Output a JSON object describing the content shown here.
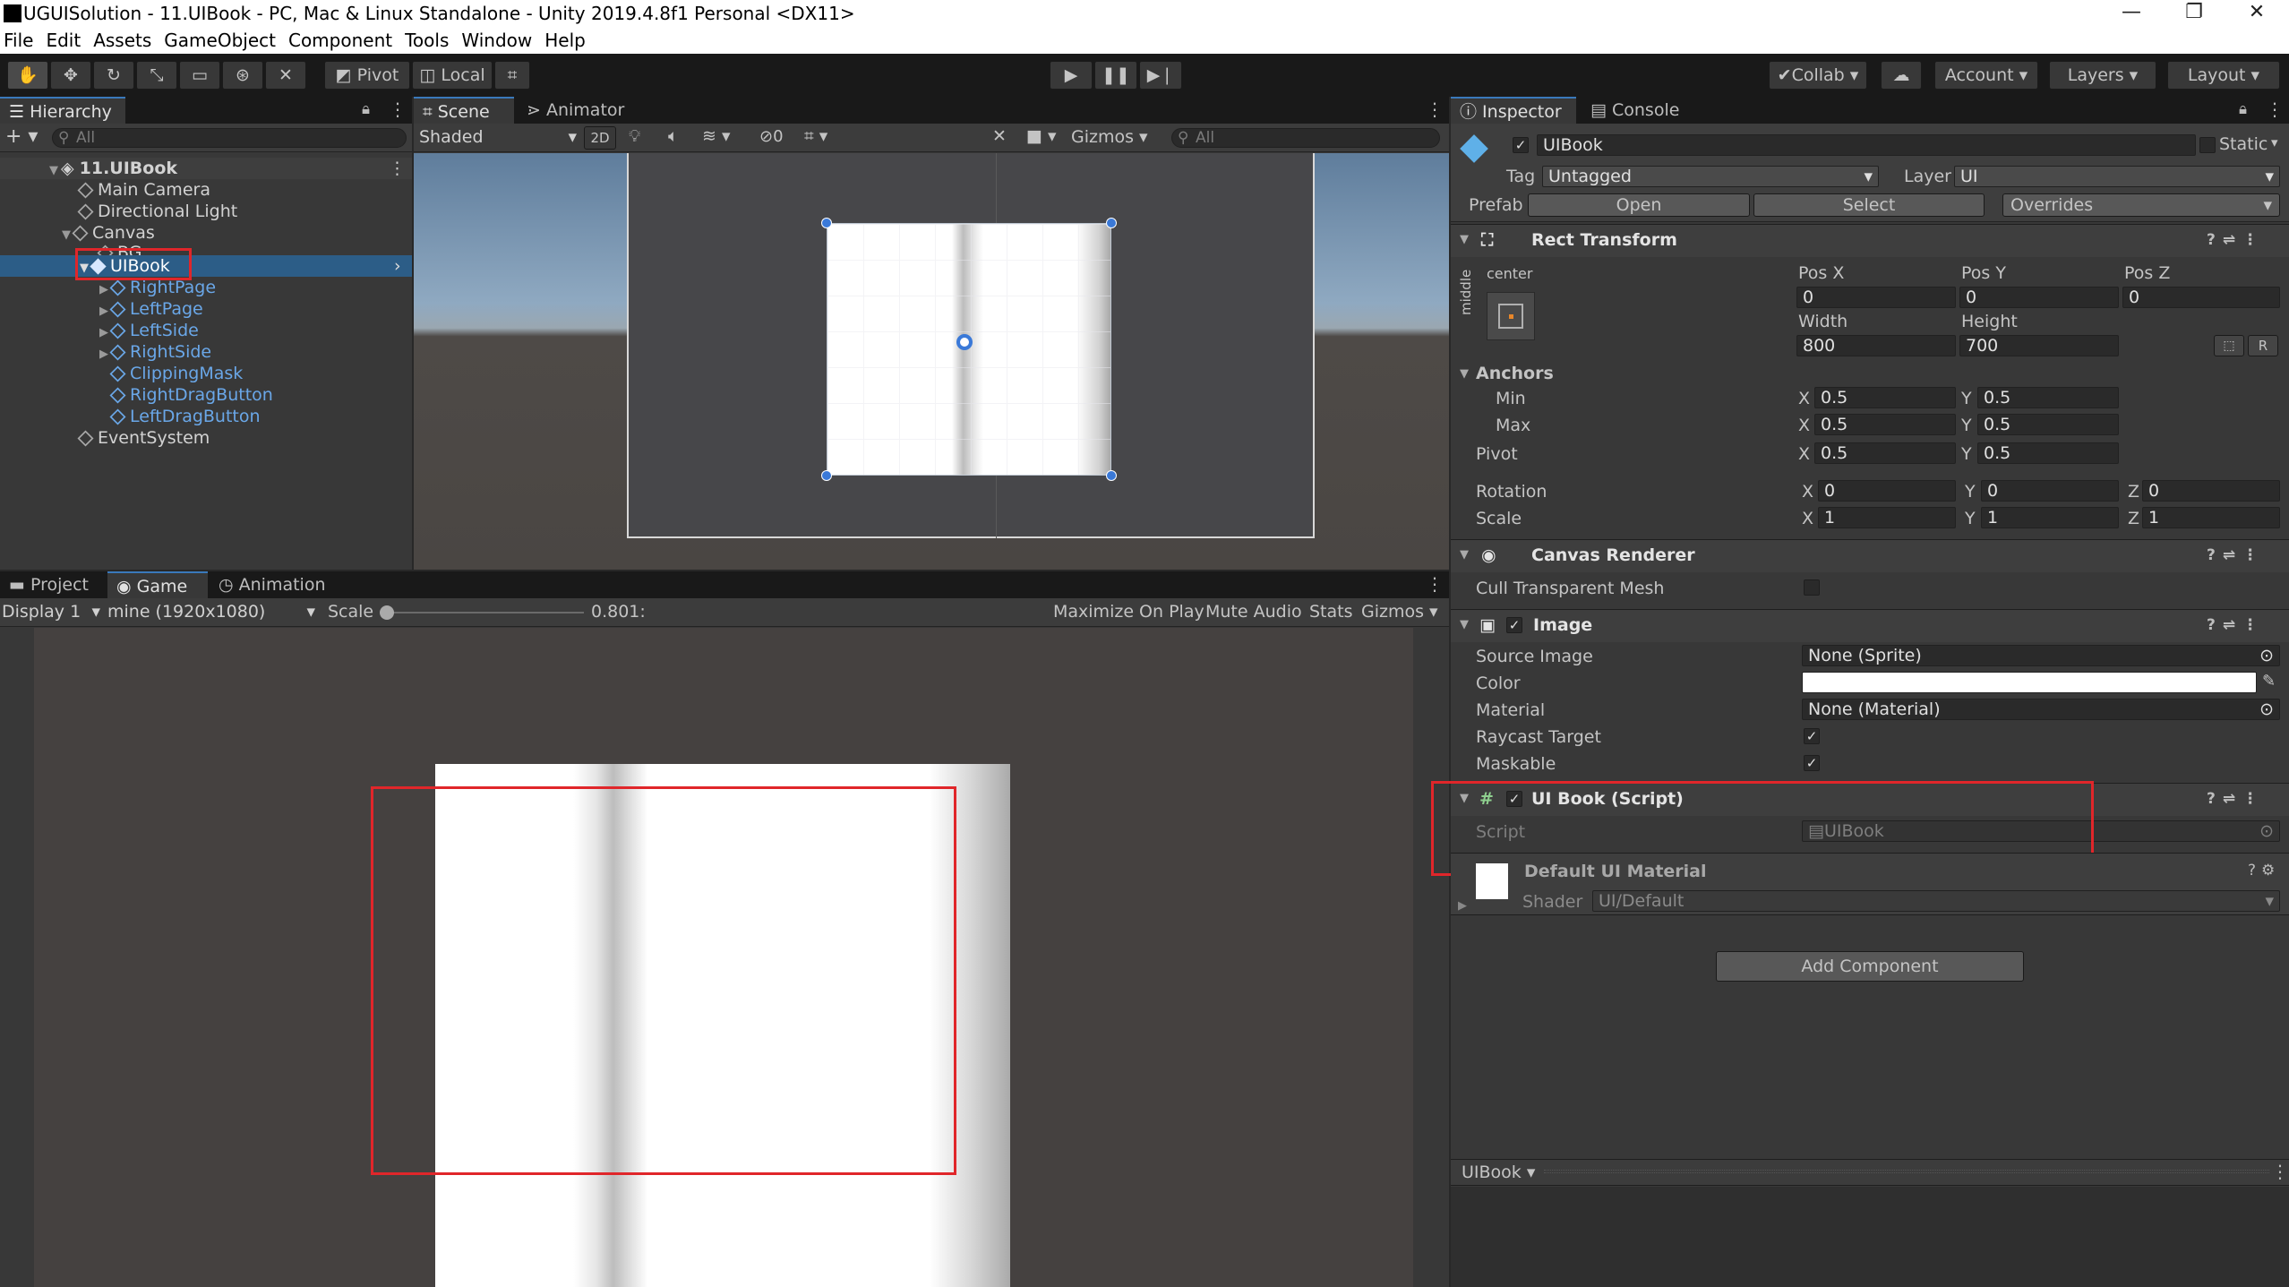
{
  "window": {
    "title": "UGUISolution - 11.UIBook - PC, Mac & Linux Standalone - Unity 2019.4.8f1 Personal <DX11>",
    "minimize": "—",
    "maximize": "❐",
    "close": "✕"
  },
  "menu": [
    "File",
    "Edit",
    "Assets",
    "GameObject",
    "Component",
    "Tools",
    "Window",
    "Help"
  ],
  "toolbar": {
    "pivot": "Pivot",
    "local": "Local",
    "collab": "Collab",
    "account": "Account",
    "layers": "Layers",
    "layout": "Layout"
  },
  "hierarchy": {
    "tab": "Hierarchy",
    "add": "+",
    "search_placeholder": "All",
    "scene": "11.UIBook",
    "items": [
      {
        "label": "Main Camera"
      },
      {
        "label": "Directional Light"
      },
      {
        "label": "Canvas"
      },
      {
        "label": "BG"
      },
      {
        "label": "UIBook"
      },
      {
        "label": "RightPage"
      },
      {
        "label": "LeftPage"
      },
      {
        "label": "LeftSide"
      },
      {
        "label": "RightSide"
      },
      {
        "label": "ClippingMask"
      },
      {
        "label": "RightDragButton"
      },
      {
        "label": "LeftDragButton"
      },
      {
        "label": "EventSystem"
      }
    ]
  },
  "scene_view": {
    "tab_scene": "Scene",
    "tab_animator": "Animator",
    "shading": "Shaded",
    "mode_2d": "2D",
    "hidden_count": "0",
    "gizmos": "Gizmos",
    "search_placeholder": "All"
  },
  "game_view": {
    "tab_project": "Project",
    "tab_game": "Game",
    "tab_animation": "Animation",
    "display": "Display 1",
    "resolution": "mine (1920x1080)",
    "scale_label": "Scale",
    "scale_value": "0.801:",
    "maximize_on_play": "Maximize On Play",
    "mute_audio": "Mute Audio",
    "stats": "Stats",
    "gizmos": "Gizmos"
  },
  "inspector": {
    "tab_inspector": "Inspector",
    "tab_console": "Console",
    "object_name": "UIBook",
    "static_label": "Static",
    "tag_label": "Tag",
    "tag_value": "Untagged",
    "layer_label": "Layer",
    "layer_value": "UI",
    "prefab_label": "Prefab",
    "prefab_open": "Open",
    "prefab_select": "Select",
    "prefab_overrides": "Overrides",
    "rect_transform": {
      "title": "Rect Transform",
      "anchor_h": "center",
      "anchor_v": "middle",
      "pos_x_label": "Pos X",
      "pos_x": "0",
      "pos_y_label": "Pos Y",
      "pos_y": "0",
      "pos_z_label": "Pos Z",
      "pos_z": "0",
      "width_label": "Width",
      "width": "800",
      "height_label": "Height",
      "height": "700",
      "r_button": "R",
      "anchors_label": "Anchors",
      "min_label": "Min",
      "min_x": "0.5",
      "min_y": "0.5",
      "max_label": "Max",
      "max_x": "0.5",
      "max_y": "0.5",
      "pivot_label": "Pivot",
      "pivot_x": "0.5",
      "pivot_y": "0.5",
      "rotation_label": "Rotation",
      "rot_x": "0",
      "rot_y": "0",
      "rot_z": "0",
      "scale_label": "Scale",
      "scale_x": "1",
      "scale_y": "1",
      "scale_z": "1",
      "x": "X",
      "y": "Y",
      "z": "Z"
    },
    "canvas_renderer": {
      "title": "Canvas Renderer",
      "cull_label": "Cull Transparent Mesh"
    },
    "image": {
      "title": "Image",
      "source_label": "Source Image",
      "source_value": "None (Sprite)",
      "color_label": "Color",
      "color_value": "#ffffff",
      "material_label": "Material",
      "material_value": "None (Material)",
      "raycast_label": "Raycast Target",
      "maskable_label": "Maskable"
    },
    "script": {
      "title": "UI Book (Script)",
      "script_label": "Script",
      "script_value": "UIBook"
    },
    "material": {
      "title": "Default UI Material",
      "shader_label": "Shader",
      "shader_value": "UI/Default"
    },
    "add_component": "Add Component",
    "preview": "UIBook"
  },
  "colors": {
    "accent": "#3a79bb",
    "selection": "#2c5d87",
    "child_link": "#6aa7e8",
    "highlight_box": "#e0262a"
  }
}
